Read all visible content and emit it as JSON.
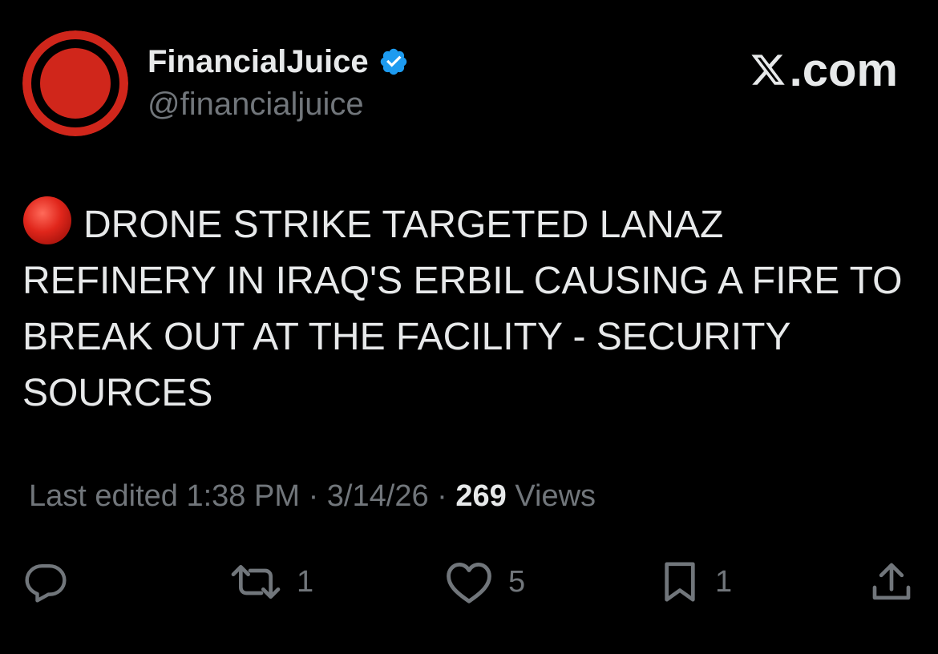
{
  "author": {
    "display_name": "FinancialJuice",
    "handle": "@financialjuice",
    "verified_icon": "verified-badge-icon",
    "avatar_colors": {
      "ring": "#d0261b",
      "fill": "#d0261b"
    }
  },
  "brand": {
    "label": ".com",
    "icon": "x-logo-icon"
  },
  "tweet": {
    "emoji": "red-circle-emoji",
    "text": "DRONE STRIKE TARGETED LANAZ REFINERY IN IRAQ'S ERBIL CAUSING A FIRE TO BREAK OUT AT THE FACILITY - SECURITY SOURCES"
  },
  "meta": {
    "edited_label": "Last edited",
    "time": "1:38 PM",
    "separator": "·",
    "date": "3/14/26",
    "views_count": "269",
    "views_label": "Views"
  },
  "actions": {
    "reply": {
      "icon": "reply-icon",
      "count": ""
    },
    "repost": {
      "icon": "repost-icon",
      "count": "1"
    },
    "like": {
      "icon": "heart-icon",
      "count": "5"
    },
    "bookmark": {
      "icon": "bookmark-icon",
      "count": "1"
    },
    "share": {
      "icon": "share-icon"
    }
  },
  "colors": {
    "background": "#000000",
    "primary_text": "#e7e9ea",
    "secondary_text": "#71767b",
    "verified_blue": "#1d9bf0",
    "accent_red": "#d0261b"
  }
}
